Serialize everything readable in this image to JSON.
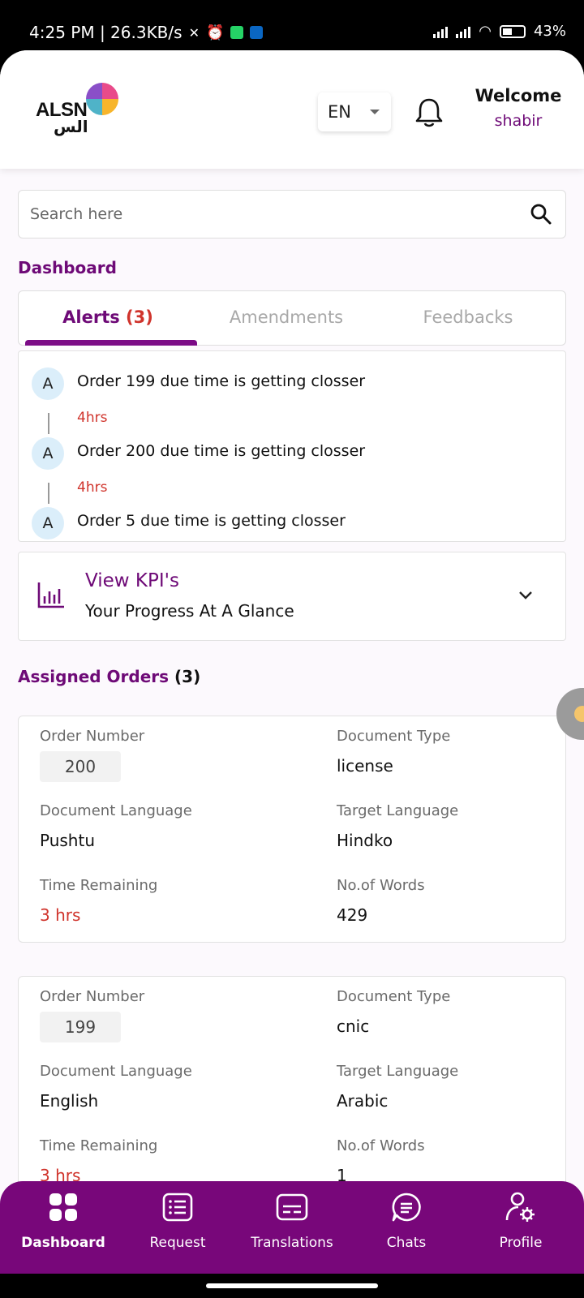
{
  "status_bar": {
    "time_speed": "4:25 PM | 26.3KB/s",
    "battery": "43"
  },
  "header": {
    "logo_en": "ALSN",
    "logo_ar": "الس",
    "language": "EN",
    "welcome_title": "Welcome",
    "user_name": "shabir"
  },
  "search": {
    "placeholder": "Search here"
  },
  "dashboard": {
    "title": "Dashboard",
    "tabs": [
      {
        "label": "Alerts",
        "count": "(3)"
      },
      {
        "label": "Amendments"
      },
      {
        "label": "Feedbacks"
      }
    ],
    "alerts": [
      {
        "avatar": "A",
        "text": "Order 199 due time is getting closser",
        "time": "4hrs"
      },
      {
        "avatar": "A",
        "text": "Order 200 due time is getting closser",
        "time": "4hrs"
      },
      {
        "avatar": "A",
        "text": "Order 5 due time is getting closser"
      }
    ]
  },
  "kpi": {
    "title": "View KPI's",
    "subtitle": "Your Progress At A Glance"
  },
  "assigned_orders": {
    "title": "Assigned Orders",
    "count": "(3)",
    "labels": {
      "order_number": "Order Number",
      "document_type": "Document Type",
      "document_language": "Document Language",
      "target_language": "Target Language",
      "time_remaining": "Time Remaining",
      "words": "No.of Words"
    },
    "orders": [
      {
        "order_number": "200",
        "document_type": "license",
        "document_language": "Pushtu",
        "target_language": "Hindko",
        "time_remaining": "3 hrs",
        "words": "429"
      },
      {
        "order_number": "199",
        "document_type": "cnic",
        "document_language": "English",
        "target_language": "Arabic",
        "time_remaining": "3 hrs",
        "words": "1"
      }
    ]
  },
  "bottom_nav": [
    {
      "label": "Dashboard",
      "icon": "grid-icon"
    },
    {
      "label": "Request",
      "icon": "list-icon"
    },
    {
      "label": "Translations",
      "icon": "subtitles-icon"
    },
    {
      "label": "Chats",
      "icon": "chat-icon"
    },
    {
      "label": "Profile",
      "icon": "user-settings-icon"
    }
  ],
  "colors": {
    "brand": "#78077A",
    "accent_text": "#6E0A77",
    "alert_red": "#D0342C",
    "avatar_bg": "#DBEEFA"
  }
}
